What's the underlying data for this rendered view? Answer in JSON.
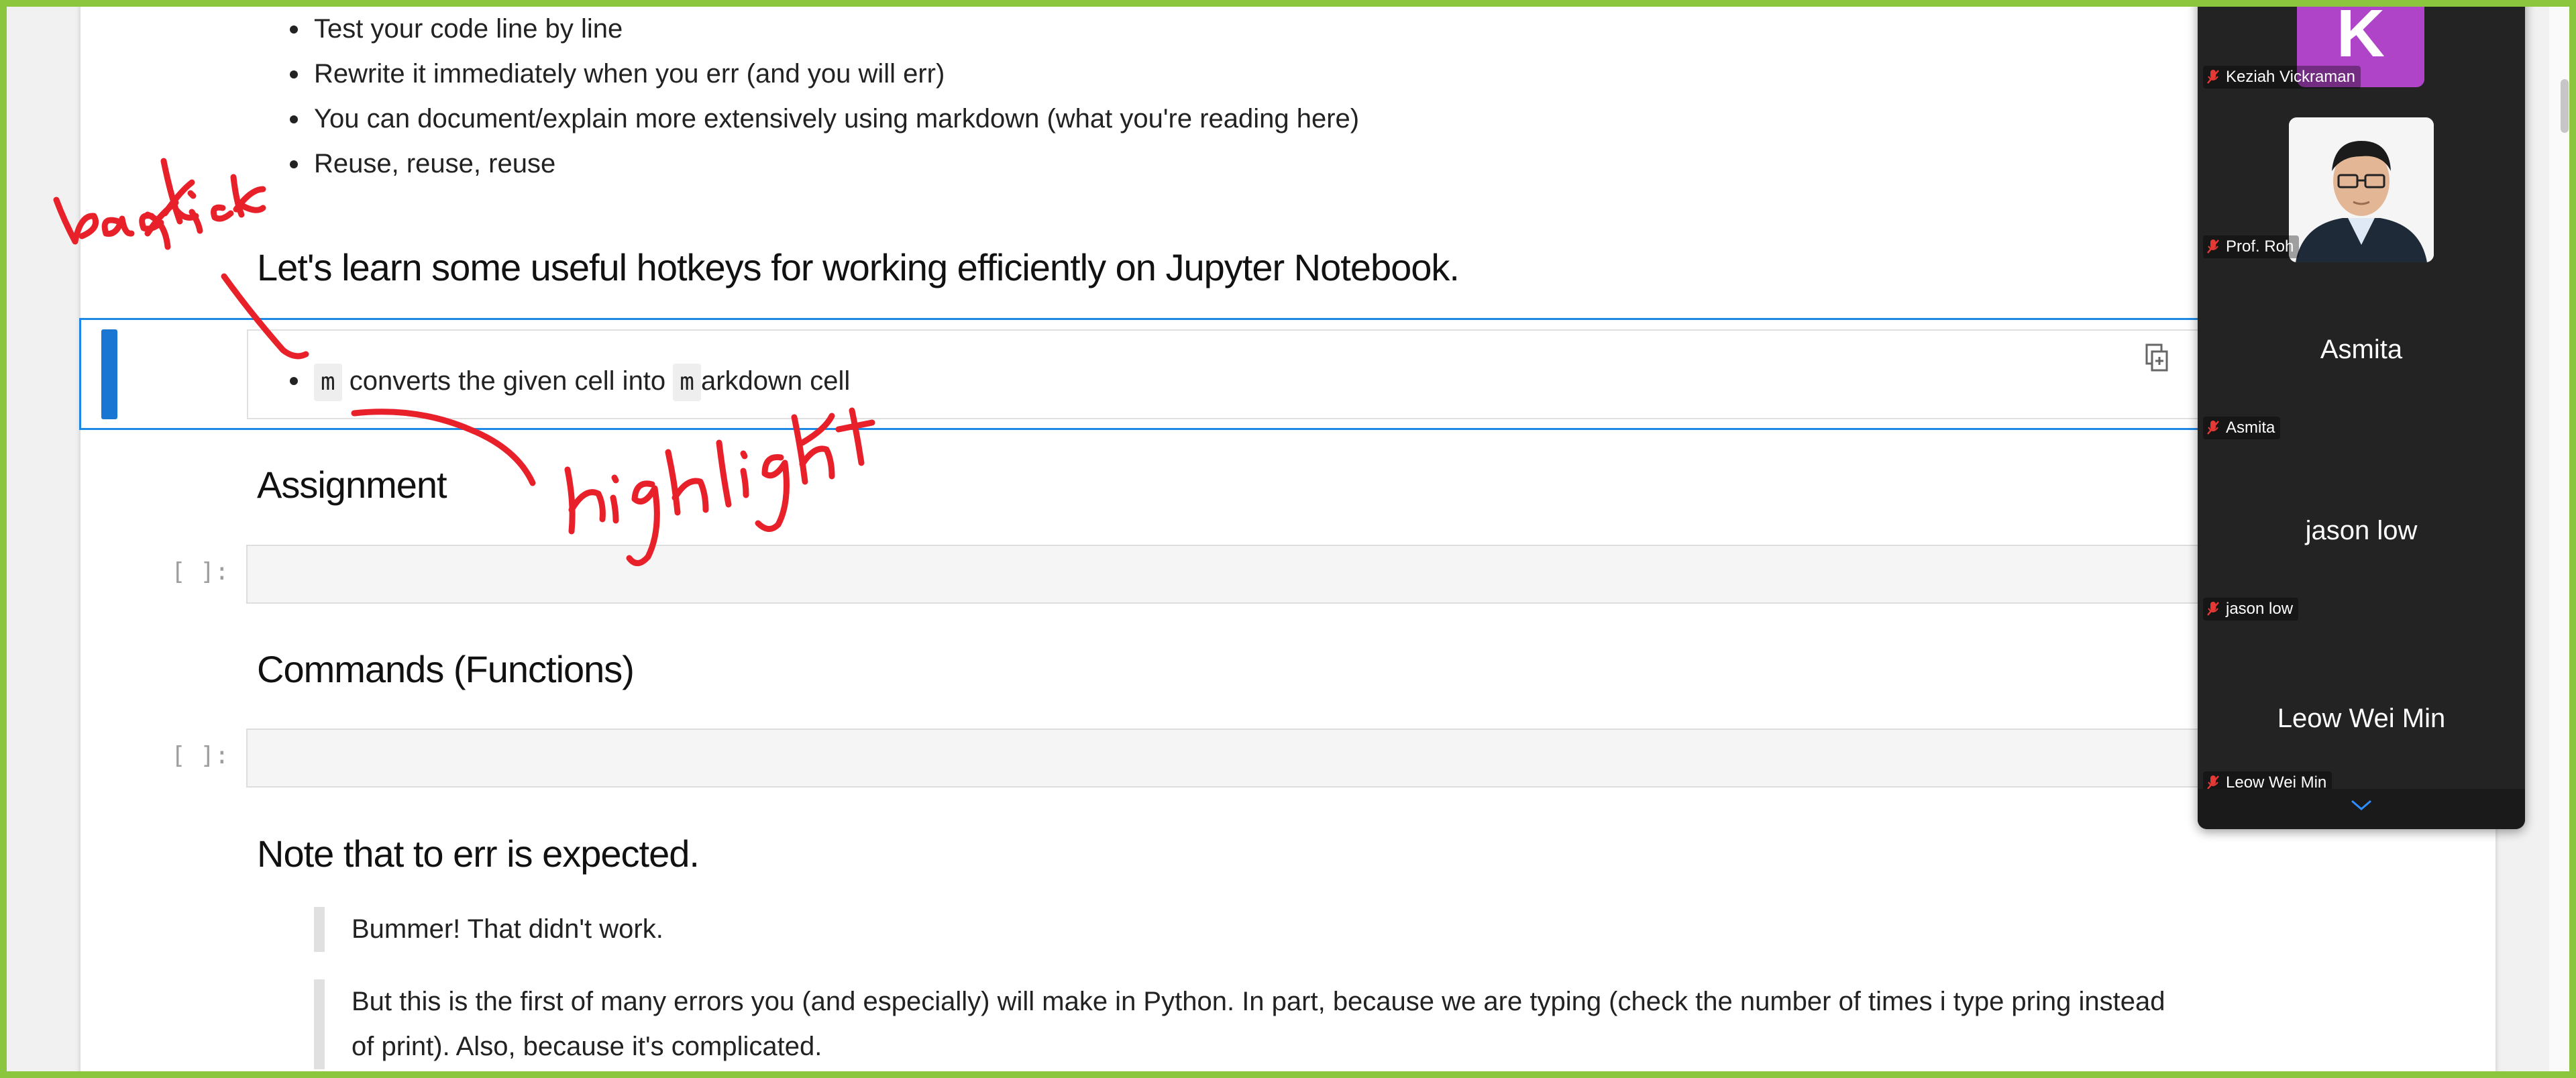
{
  "intro_bullets": [
    "Test your code line by line",
    "Rewrite it immediately when you err (and you will err)",
    "You can document/explain more extensively using markdown (what you're reading here)",
    "Reuse, reuse, reuse"
  ],
  "hotkeys_heading": "Let's learn some useful hotkeys for working efficiently on Jupyter Notebook.",
  "selected_cell": {
    "key1": "m",
    "text1": " converts the given cell into ",
    "key2": "m",
    "text2": "arkdown cell"
  },
  "assignment_heading": "Assignment",
  "commands_heading": "Commands (Functions)",
  "code_prompt": "[ ]:",
  "note_heading": "Note that to err is expected.",
  "quotes": [
    "Bummer! That didn't work.",
    "But this is the first of many errors you (and especially) will make in Python. In part, because we are typing (check the number of times i type pring instead",
    "of print). Also, because it's complicated."
  ],
  "annotations": {
    "top_left": "back tick",
    "arrow_label": "highlight",
    "ink_color": "#e8202a"
  },
  "zoom_panel": {
    "avatar_letter": "K",
    "participants": [
      {
        "tag": "Keziah Vickraman"
      },
      {
        "tag": "Prof. Roh"
      },
      {
        "name": "Asmita",
        "tag": "Asmita"
      },
      {
        "name": "jason low",
        "tag": "jason low"
      },
      {
        "name": "Leow Wei Min",
        "tag": "Leow Wei Min"
      }
    ]
  },
  "colors": {
    "frame": "#8cc63f",
    "selection": "#1e88e5",
    "avatar_bg": "#b044c8"
  }
}
